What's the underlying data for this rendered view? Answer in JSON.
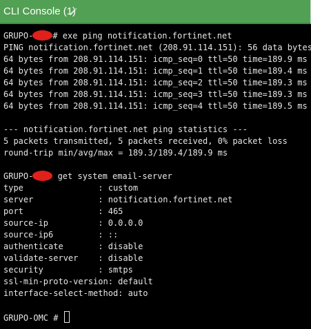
{
  "window": {
    "title": "CLI Console (1)",
    "edit_icon": "pencil-icon",
    "accent_color": "#52a054"
  },
  "terminal": {
    "ping_prompt_host": "GRUPO-",
    "ping_command": "# exe ping notification.fortinet.net",
    "ping_header": "PING notification.fortinet.net (208.91.114.151): 56 data bytes",
    "ping_replies": [
      "64 bytes from 208.91.114.151: icmp_seq=0 ttl=50 time=189.9 ms",
      "64 bytes from 208.91.114.151: icmp_seq=1 ttl=50 time=189.4 ms",
      "64 bytes from 208.91.114.151: icmp_seq=2 ttl=50 time=189.3 ms",
      "64 bytes from 208.91.114.151: icmp_seq=3 ttl=50 time=189.3 ms",
      "64 bytes from 208.91.114.151: icmp_seq=4 ttl=50 time=189.5 ms"
    ],
    "stats_header": "--- notification.fortinet.net ping statistics ---",
    "stats_packets": "5 packets transmitted, 5 packets received, 0% packet loss",
    "stats_rtt": "round-trip min/avg/max = 189.3/189.4/189.9 ms",
    "email_prompt_host": "GRUPO-",
    "email_command": " get system email-server",
    "email_config": [
      "type               : custom",
      "server             : notification.fortinet.net",
      "port               : 465",
      "source-ip          : 0.0.0.0",
      "source-ip6         : ::",
      "authenticate       : disable",
      "validate-server    : disable",
      "security           : smtps",
      "ssl-min-proto-version: default",
      "interface-select-method: auto"
    ],
    "final_prompt": "GRUPO-OMC # ",
    "redaction_color": "#e0201a"
  }
}
